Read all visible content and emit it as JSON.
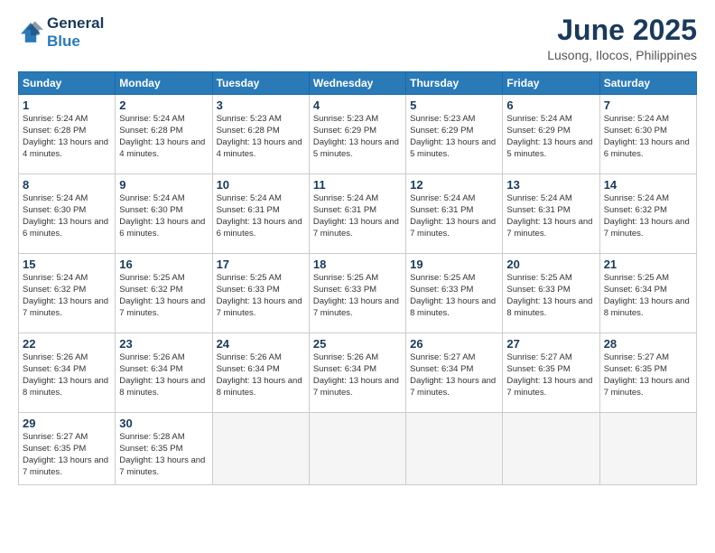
{
  "header": {
    "logo_line1": "General",
    "logo_line2": "Blue",
    "title": "June 2025",
    "subtitle": "Lusong, Ilocos, Philippines"
  },
  "days_of_week": [
    "Sunday",
    "Monday",
    "Tuesday",
    "Wednesday",
    "Thursday",
    "Friday",
    "Saturday"
  ],
  "weeks": [
    [
      {
        "day": 1,
        "sunrise": "5:24 AM",
        "sunset": "6:28 PM",
        "daylight": "13 hours and 4 minutes."
      },
      {
        "day": 2,
        "sunrise": "5:24 AM",
        "sunset": "6:28 PM",
        "daylight": "13 hours and 4 minutes."
      },
      {
        "day": 3,
        "sunrise": "5:23 AM",
        "sunset": "6:28 PM",
        "daylight": "13 hours and 4 minutes."
      },
      {
        "day": 4,
        "sunrise": "5:23 AM",
        "sunset": "6:29 PM",
        "daylight": "13 hours and 5 minutes."
      },
      {
        "day": 5,
        "sunrise": "5:23 AM",
        "sunset": "6:29 PM",
        "daylight": "13 hours and 5 minutes."
      },
      {
        "day": 6,
        "sunrise": "5:24 AM",
        "sunset": "6:29 PM",
        "daylight": "13 hours and 5 minutes."
      },
      {
        "day": 7,
        "sunrise": "5:24 AM",
        "sunset": "6:30 PM",
        "daylight": "13 hours and 6 minutes."
      }
    ],
    [
      {
        "day": 8,
        "sunrise": "5:24 AM",
        "sunset": "6:30 PM",
        "daylight": "13 hours and 6 minutes."
      },
      {
        "day": 9,
        "sunrise": "5:24 AM",
        "sunset": "6:30 PM",
        "daylight": "13 hours and 6 minutes."
      },
      {
        "day": 10,
        "sunrise": "5:24 AM",
        "sunset": "6:31 PM",
        "daylight": "13 hours and 6 minutes."
      },
      {
        "day": 11,
        "sunrise": "5:24 AM",
        "sunset": "6:31 PM",
        "daylight": "13 hours and 7 minutes."
      },
      {
        "day": 12,
        "sunrise": "5:24 AM",
        "sunset": "6:31 PM",
        "daylight": "13 hours and 7 minutes."
      },
      {
        "day": 13,
        "sunrise": "5:24 AM",
        "sunset": "6:31 PM",
        "daylight": "13 hours and 7 minutes."
      },
      {
        "day": 14,
        "sunrise": "5:24 AM",
        "sunset": "6:32 PM",
        "daylight": "13 hours and 7 minutes."
      }
    ],
    [
      {
        "day": 15,
        "sunrise": "5:24 AM",
        "sunset": "6:32 PM",
        "daylight": "13 hours and 7 minutes."
      },
      {
        "day": 16,
        "sunrise": "5:25 AM",
        "sunset": "6:32 PM",
        "daylight": "13 hours and 7 minutes."
      },
      {
        "day": 17,
        "sunrise": "5:25 AM",
        "sunset": "6:33 PM",
        "daylight": "13 hours and 7 minutes."
      },
      {
        "day": 18,
        "sunrise": "5:25 AM",
        "sunset": "6:33 PM",
        "daylight": "13 hours and 7 minutes."
      },
      {
        "day": 19,
        "sunrise": "5:25 AM",
        "sunset": "6:33 PM",
        "daylight": "13 hours and 8 minutes."
      },
      {
        "day": 20,
        "sunrise": "5:25 AM",
        "sunset": "6:33 PM",
        "daylight": "13 hours and 8 minutes."
      },
      {
        "day": 21,
        "sunrise": "5:25 AM",
        "sunset": "6:34 PM",
        "daylight": "13 hours and 8 minutes."
      }
    ],
    [
      {
        "day": 22,
        "sunrise": "5:26 AM",
        "sunset": "6:34 PM",
        "daylight": "13 hours and 8 minutes."
      },
      {
        "day": 23,
        "sunrise": "5:26 AM",
        "sunset": "6:34 PM",
        "daylight": "13 hours and 8 minutes."
      },
      {
        "day": 24,
        "sunrise": "5:26 AM",
        "sunset": "6:34 PM",
        "daylight": "13 hours and 8 minutes."
      },
      {
        "day": 25,
        "sunrise": "5:26 AM",
        "sunset": "6:34 PM",
        "daylight": "13 hours and 7 minutes."
      },
      {
        "day": 26,
        "sunrise": "5:27 AM",
        "sunset": "6:34 PM",
        "daylight": "13 hours and 7 minutes."
      },
      {
        "day": 27,
        "sunrise": "5:27 AM",
        "sunset": "6:35 PM",
        "daylight": "13 hours and 7 minutes."
      },
      {
        "day": 28,
        "sunrise": "5:27 AM",
        "sunset": "6:35 PM",
        "daylight": "13 hours and 7 minutes."
      }
    ],
    [
      {
        "day": 29,
        "sunrise": "5:27 AM",
        "sunset": "6:35 PM",
        "daylight": "13 hours and 7 minutes."
      },
      {
        "day": 30,
        "sunrise": "5:28 AM",
        "sunset": "6:35 PM",
        "daylight": "13 hours and 7 minutes."
      },
      null,
      null,
      null,
      null,
      null
    ]
  ]
}
